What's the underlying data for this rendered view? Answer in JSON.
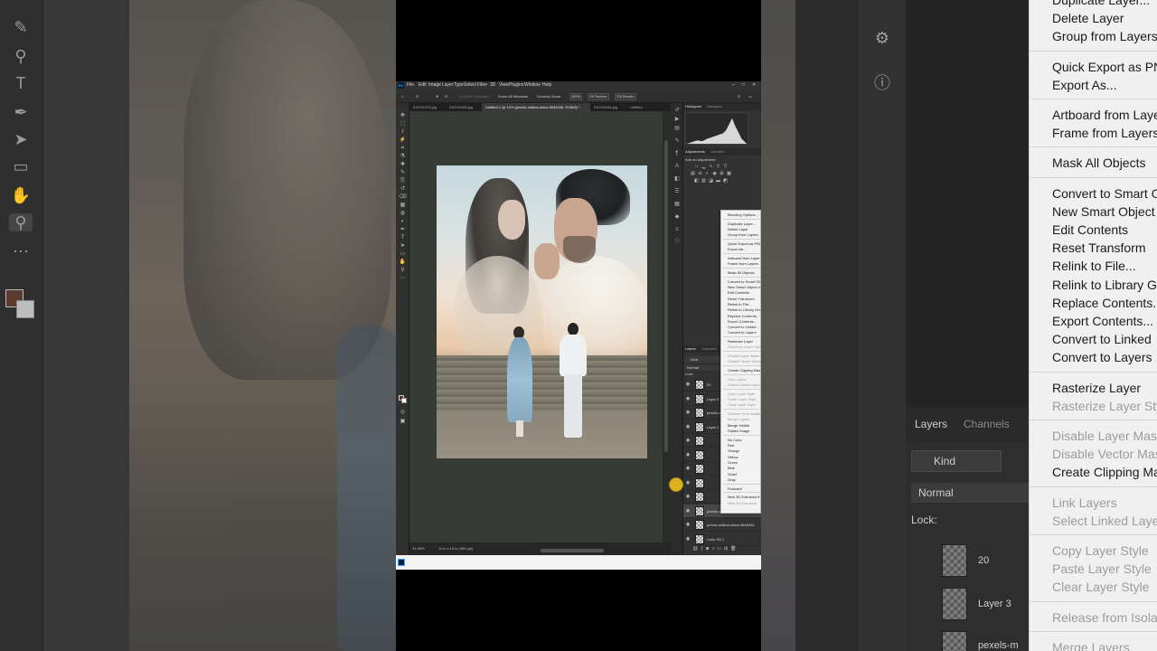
{
  "background_left": {
    "tool_icons": [
      "brush-icon",
      "search-icon",
      "type-icon",
      "pen-icon",
      "select-icon",
      "rectangle-icon",
      "hand-icon",
      "zoom-icon",
      "more-icon"
    ]
  },
  "background_right": {
    "menu_items": [
      {
        "label": "Duplicate Layer...",
        "disabled": false
      },
      {
        "label": "Delete Layer",
        "disabled": false
      },
      {
        "label": "Group from Layers",
        "disabled": false
      },
      {
        "label": "Quick Export as PNG",
        "disabled": false
      },
      {
        "label": "Export As...",
        "disabled": false
      },
      {
        "label": "Artboard from Layers",
        "disabled": false
      },
      {
        "label": "Frame from Layers",
        "disabled": false
      },
      {
        "label": "Mask All Objects",
        "disabled": false
      },
      {
        "label": "Convert to Smart Object",
        "disabled": false
      },
      {
        "label": "New Smart Object via Copy",
        "disabled": false
      },
      {
        "label": "Edit Contents",
        "disabled": false
      },
      {
        "label": "Reset Transform",
        "disabled": false
      },
      {
        "label": "Relink to File...",
        "disabled": false
      },
      {
        "label": "Relink to Library Graphic",
        "disabled": false
      },
      {
        "label": "Replace Contents...",
        "disabled": false
      },
      {
        "label": "Export Contents...",
        "disabled": false
      },
      {
        "label": "Convert to Linked",
        "disabled": false
      },
      {
        "label": "Convert to Layers",
        "disabled": false
      },
      {
        "label": "Rasterize Layer",
        "disabled": false
      },
      {
        "label": "Rasterize Layer Style",
        "disabled": true
      },
      {
        "label": "Disable Layer Mask",
        "disabled": true
      },
      {
        "label": "Disable Vector Mask",
        "disabled": true
      },
      {
        "label": "Create Clipping Mask",
        "disabled": false
      },
      {
        "label": "Link Layers",
        "disabled": true
      },
      {
        "label": "Select Linked Layers",
        "disabled": true
      },
      {
        "label": "Copy Layer Style",
        "disabled": true
      },
      {
        "label": "Paste Layer Style",
        "disabled": true
      },
      {
        "label": "Clear Layer Style",
        "disabled": true
      },
      {
        "label": "Release from Isolation",
        "disabled": true
      },
      {
        "label": "Merge Layers",
        "disabled": true
      }
    ],
    "layers_tab": "Layers",
    "channels_tab": "Channels",
    "kind_label": "Kind",
    "blend_mode": "Normal",
    "lock_label": "Lock:",
    "layers": [
      "20",
      "Layer 3",
      "pexels-m"
    ]
  },
  "photoshop": {
    "menu": [
      "File",
      "Edit",
      "Image",
      "Layer",
      "Type",
      "Select",
      "Filter",
      "3D",
      "View",
      "Plugins",
      "Window",
      "Help"
    ],
    "options": {
      "scroll_all": "Scroll All Windows",
      "zoom_all": "Zoom All Windows",
      "scrubby": "Scrubby Zoom",
      "zoom_pct": "100%",
      "fit_screen": "Fit Screen",
      "fill_screen": "Fill Screen"
    },
    "tabs": [
      {
        "label": "DSC00475.jpg",
        "active": false
      },
      {
        "label": "DSC00453.jpg",
        "active": false
      },
      {
        "label": "Untitled-1 @ 10% (pexels-mälina-shina-9645436, RGB/8) *",
        "active": true
      },
      {
        "label": "DSC00434.jpg",
        "active": false
      },
      {
        "label": "Untitled",
        "active": false
      }
    ],
    "status": {
      "zoom": "31.08%",
      "size": "11 in x 16 in (300 ppi)"
    },
    "panels": {
      "histogram": "Histogram",
      "navigator": "Navigator",
      "adjustments": "Adjustments",
      "libraries": "Libraries",
      "add_adjustment": "Add an adjustment",
      "layers": "Layers",
      "channels": "Channels",
      "kind": "Kind",
      "normal": "Normal",
      "lock": "Lock:"
    },
    "layers": [
      {
        "name": "20",
        "selected": false
      },
      {
        "name": "Layer 3",
        "selected": false
      },
      {
        "name": "pexels-mä",
        "selected": false
      },
      {
        "name": "Layer 2",
        "selected": false
      },
      {
        "name": "",
        "selected": false
      },
      {
        "name": "",
        "selected": false
      },
      {
        "name": "",
        "selected": false
      },
      {
        "name": "",
        "selected": false
      },
      {
        "name": "",
        "selected": false
      },
      {
        "name": "pexels-mä",
        "selected": true
      },
      {
        "name": "pexels-mälina-shina-9645436",
        "selected": false
      },
      {
        "name": "Color Fill 1",
        "selected": false
      }
    ]
  },
  "context_menu": {
    "items": [
      {
        "label": "Blending Options...",
        "disabled": false
      },
      {
        "label": "Duplicate Layer...",
        "disabled": false
      },
      {
        "label": "Delete Layer",
        "disabled": false
      },
      {
        "label": "Group from Layers...",
        "disabled": false
      },
      {
        "label": "Quick Export as PNG",
        "disabled": false
      },
      {
        "label": "Export As...",
        "disabled": false
      },
      {
        "label": "Artboard from Layers...",
        "disabled": false
      },
      {
        "label": "Frame from Layers...",
        "disabled": false
      },
      {
        "label": "Mask All Objects",
        "disabled": false
      },
      {
        "label": "Convert to Smart Object",
        "disabled": false
      },
      {
        "label": "New Smart Object via Copy",
        "disabled": false
      },
      {
        "label": "Edit Contents",
        "disabled": false
      },
      {
        "label": "Reset Transform",
        "disabled": false
      },
      {
        "label": "Relink to File...",
        "disabled": false
      },
      {
        "label": "Relink to Library Graphic...",
        "disabled": false
      },
      {
        "label": "Replace Contents...",
        "disabled": false
      },
      {
        "label": "Export Contents...",
        "disabled": false
      },
      {
        "label": "Convert to Linked...",
        "disabled": false
      },
      {
        "label": "Convert to Layers",
        "disabled": false
      },
      {
        "label": "Rasterize Layer",
        "disabled": false
      },
      {
        "label": "Rasterize Layer Style",
        "disabled": true
      },
      {
        "label": "Disable Layer Mask",
        "disabled": true
      },
      {
        "label": "Disable Vector Mask",
        "disabled": true
      },
      {
        "label": "Create Clipping Mask",
        "disabled": false
      },
      {
        "label": "Link Layers",
        "disabled": true
      },
      {
        "label": "Select Linked Layers",
        "disabled": true
      },
      {
        "label": "Copy Layer Style",
        "disabled": true
      },
      {
        "label": "Paste Layer Style",
        "disabled": true
      },
      {
        "label": "Clear Layer Style",
        "disabled": true
      },
      {
        "label": "Release from Isolation",
        "disabled": true
      },
      {
        "label": "Merge Layers",
        "disabled": true
      },
      {
        "label": "Merge Visible",
        "disabled": false
      },
      {
        "label": "Flatten Image",
        "disabled": false
      },
      {
        "label": "No Color",
        "disabled": false
      },
      {
        "label": "Red",
        "disabled": false
      },
      {
        "label": "Orange",
        "disabled": false
      },
      {
        "label": "Yellow",
        "disabled": false
      },
      {
        "label": "Green",
        "disabled": false
      },
      {
        "label": "Blue",
        "disabled": false
      },
      {
        "label": "Violet",
        "disabled": false
      },
      {
        "label": "Gray",
        "disabled": false
      },
      {
        "label": "Postcard",
        "disabled": false
      },
      {
        "label": "New 3D Extrusion from Selected Layer",
        "disabled": false
      },
      {
        "label": "New 3D Extrusion",
        "disabled": true
      }
    ]
  }
}
